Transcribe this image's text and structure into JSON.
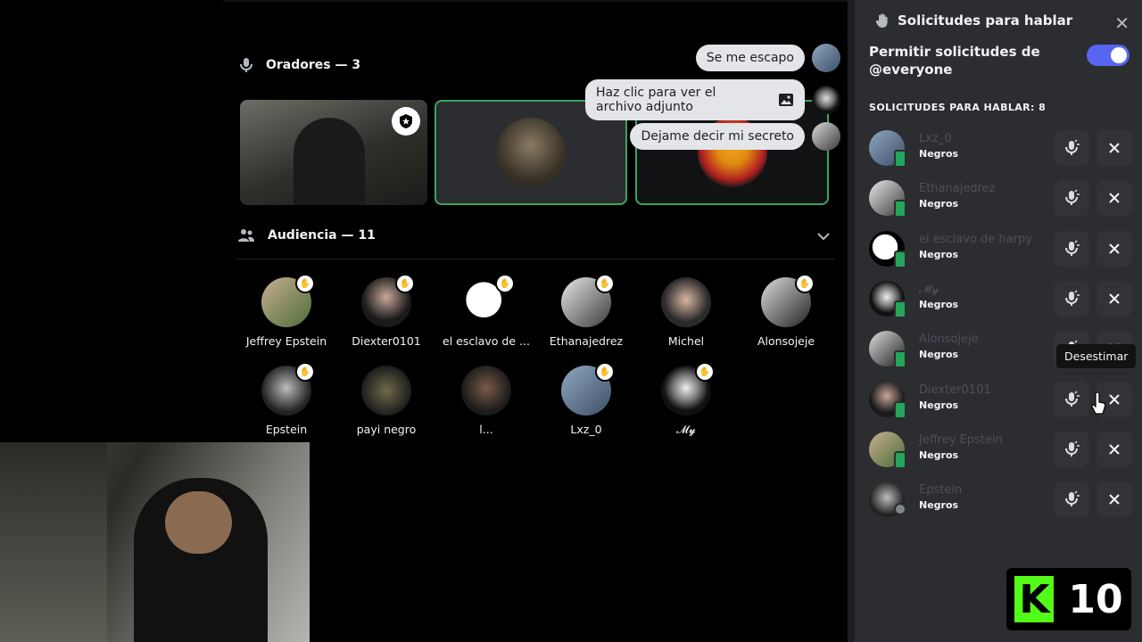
{
  "speakers": {
    "heading": "Oradores — 3"
  },
  "messages": [
    {
      "text": "Se me escapo"
    },
    {
      "text": "Haz clic para ver el archivo adjunto"
    },
    {
      "text": "Dejame decir mi secreto"
    }
  ],
  "audience": {
    "heading": "Audiencia — 11",
    "members": [
      {
        "name": "Jeffrey Epstein",
        "hand": true
      },
      {
        "name": "Diexter0101",
        "hand": true
      },
      {
        "name": "el esclavo de ...",
        "hand": true
      },
      {
        "name": "Ethanajedrez",
        "hand": true
      },
      {
        "name": "Michel",
        "hand": false
      },
      {
        "name": "Alonsojeje",
        "hand": true
      },
      {
        "name": "Epstein",
        "hand": true
      },
      {
        "name": "payi negro",
        "hand": false
      },
      {
        "name": "l...",
        "hand": false
      },
      {
        "name": "Lxz_0",
        "hand": true
      },
      {
        "name": "𝓜𝔂",
        "hand": true
      }
    ]
  },
  "panel": {
    "title": "Solicitudes para hablar",
    "toggle_label": "Permitir solicitudes de @everyone",
    "toggle_on": true,
    "requests_heading": "SOLICITUDES PARA HABLAR: 8",
    "requests": [
      {
        "name": "Lxz_0",
        "role": "Negros"
      },
      {
        "name": "Ethanajedrez",
        "role": "Negros"
      },
      {
        "name": "el esclavo de harpy",
        "role": "Negros"
      },
      {
        "name": "𝓜𝔂",
        "role": "Negros"
      },
      {
        "name": "Alonsojeje",
        "role": "Negros"
      },
      {
        "name": "Diexter0101",
        "role": "Negros"
      },
      {
        "name": "Jeffrey Epstein",
        "role": "Negros"
      },
      {
        "name": "Epstein",
        "role": "Negros"
      }
    ],
    "tooltip": "Desestimar"
  },
  "overlay": {
    "logo_letter": "K",
    "logo_number": "10"
  },
  "colors": {
    "accent": "#5865f2",
    "speaking_border": "#3ba55d",
    "panel_bg": "#2b2d31",
    "kick_green": "#53fc18"
  }
}
